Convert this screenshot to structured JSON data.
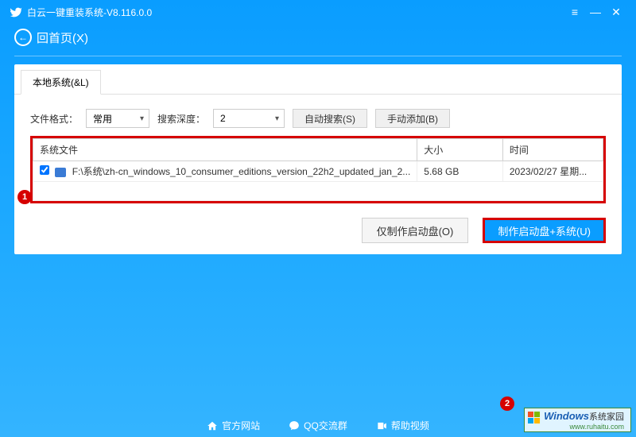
{
  "titlebar": {
    "title": "白云一键重装系统-V8.116.0.0"
  },
  "back": {
    "label": "回首页(X)"
  },
  "tab": {
    "local": "本地系统(&L)"
  },
  "controls": {
    "format_label": "文件格式：",
    "format_value": "常用",
    "depth_label": "搜索深度：",
    "depth_value": "2",
    "auto_search": "自动搜索(S)",
    "manual_add": "手动添加(B)"
  },
  "table": {
    "headers": {
      "file": "系统文件",
      "size": "大小",
      "time": "时间"
    },
    "rows": [
      {
        "checked": true,
        "path": "F:\\系统\\zh-cn_windows_10_consumer_editions_version_22h2_updated_jan_2...",
        "size": "5.68 GB",
        "time": "2023/02/27 星期..."
      }
    ]
  },
  "markers": {
    "one": "1",
    "two": "2"
  },
  "actions": {
    "make_only": "仅制作启动盘(O)",
    "make_with_system": "制作启动盘+系统(U)"
  },
  "footer": {
    "site": "官方网站",
    "qq": "QQ交流群",
    "help": "帮助视频"
  },
  "watermark": {
    "brand": "Windows",
    "suffix": "系统家园",
    "url": "www.ruhaitu.com"
  }
}
